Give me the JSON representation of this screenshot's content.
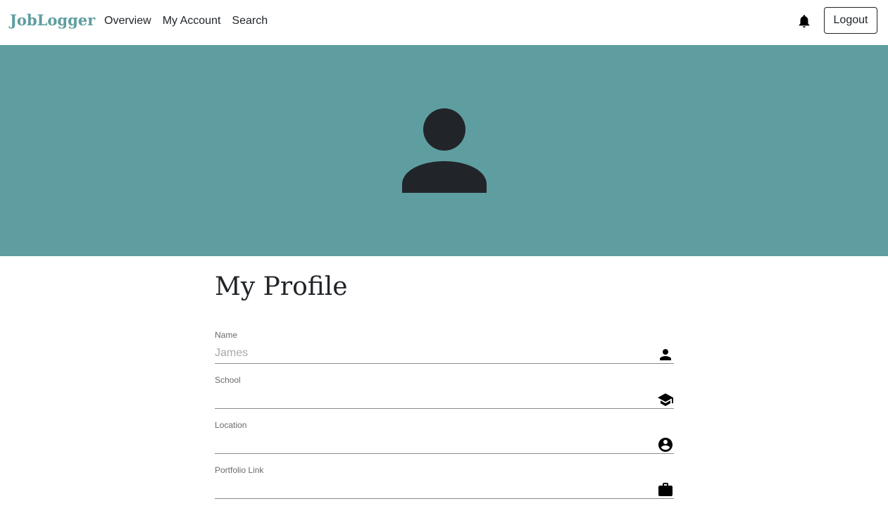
{
  "navbar": {
    "brand": "JobLogger",
    "links": [
      "Overview",
      "My Account",
      "Search"
    ],
    "bell_icon": "bell-icon",
    "logout_label": "Logout"
  },
  "hero": {
    "background_color": "#5f9ea0",
    "avatar_icon": "person-icon"
  },
  "profile": {
    "title": "My Profile",
    "fields": [
      {
        "label": "Name",
        "value": "",
        "placeholder": "James",
        "icon": "person-icon"
      },
      {
        "label": "School",
        "value": "",
        "placeholder": "",
        "icon": "graduation-cap-icon"
      },
      {
        "label": "Location",
        "value": "",
        "placeholder": "",
        "icon": "account-circle-icon"
      },
      {
        "label": "Portfolio Link",
        "value": "",
        "placeholder": "",
        "icon": "briefcase-icon"
      }
    ]
  },
  "colors": {
    "brand": "#5f9ea0",
    "text": "#212529"
  }
}
